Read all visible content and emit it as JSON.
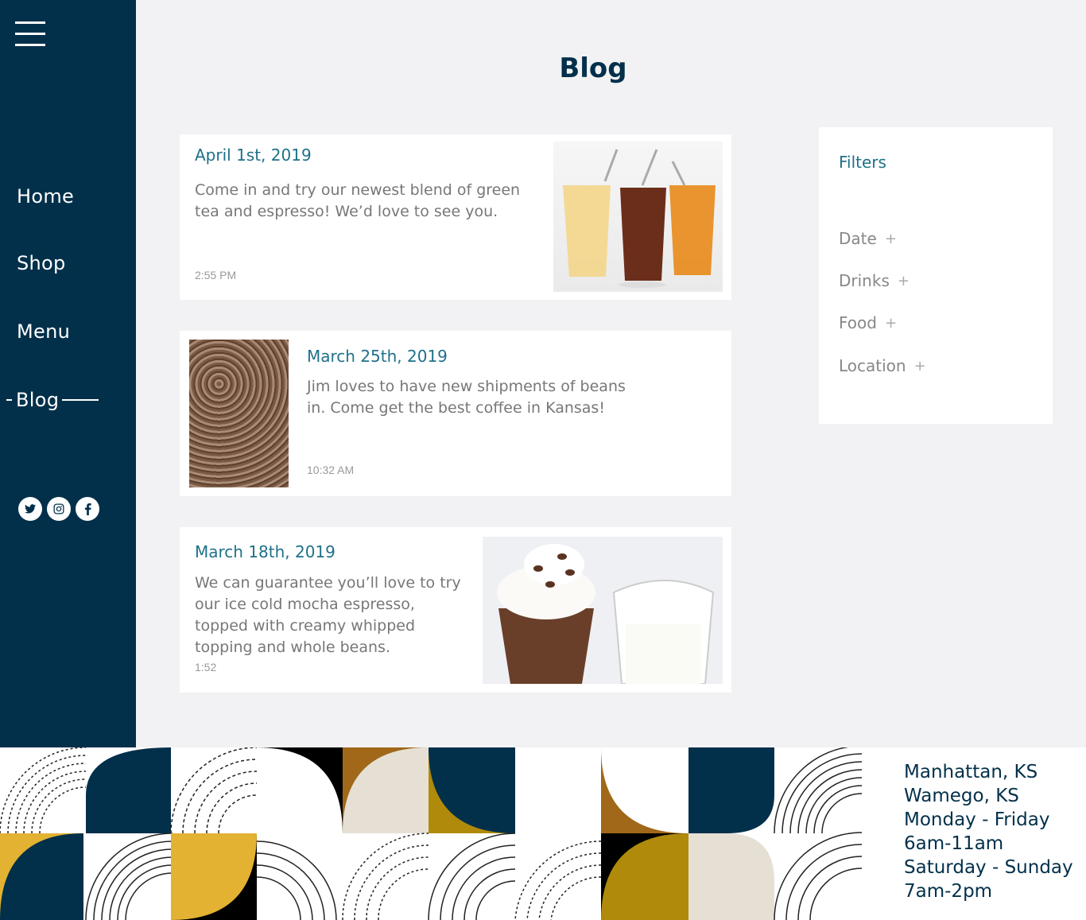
{
  "nav": {
    "items": [
      {
        "label": "Home"
      },
      {
        "label": "Shop"
      },
      {
        "label": "Menu"
      },
      {
        "label": "Blog"
      }
    ]
  },
  "page": {
    "title": "Blog"
  },
  "posts": [
    {
      "date": "April 1st, 2019",
      "text": "Come in and try our newest blend of green tea and espresso! We’d love to see you.",
      "time": "2:55 PM"
    },
    {
      "date": "March 25th, 2019",
      "text": "Jim loves to have new shipments of beans in. Come get the best coffee in Kansas!",
      "time": "10:32 AM"
    },
    {
      "date": "March 18th, 2019",
      "text": "We can guarantee you’ll love to try our ice cold mocha espresso, topped with creamy whipped topping and whole beans.",
      "time": "1:52"
    }
  ],
  "filters": {
    "title": "Filters",
    "items": [
      {
        "label": "Date"
      },
      {
        "label": "Drinks"
      },
      {
        "label": "Food"
      },
      {
        "label": "Location"
      }
    ]
  },
  "footer": {
    "lines": [
      "Manhattan, KS",
      "Wamego, KS",
      "Monday - Friday",
      "6am-11am",
      "Saturday - Sunday",
      "7am-2pm"
    ]
  },
  "colors": {
    "navy": "#02304a",
    "teal": "#1e7189",
    "gold": "#b08a0b",
    "yellow": "#e3b233",
    "brown": "#a06818",
    "cream": "#e6e0d4"
  },
  "icons": [
    "menu-icon",
    "twitter-icon",
    "instagram-icon",
    "facebook-icon",
    "plus-icon"
  ]
}
